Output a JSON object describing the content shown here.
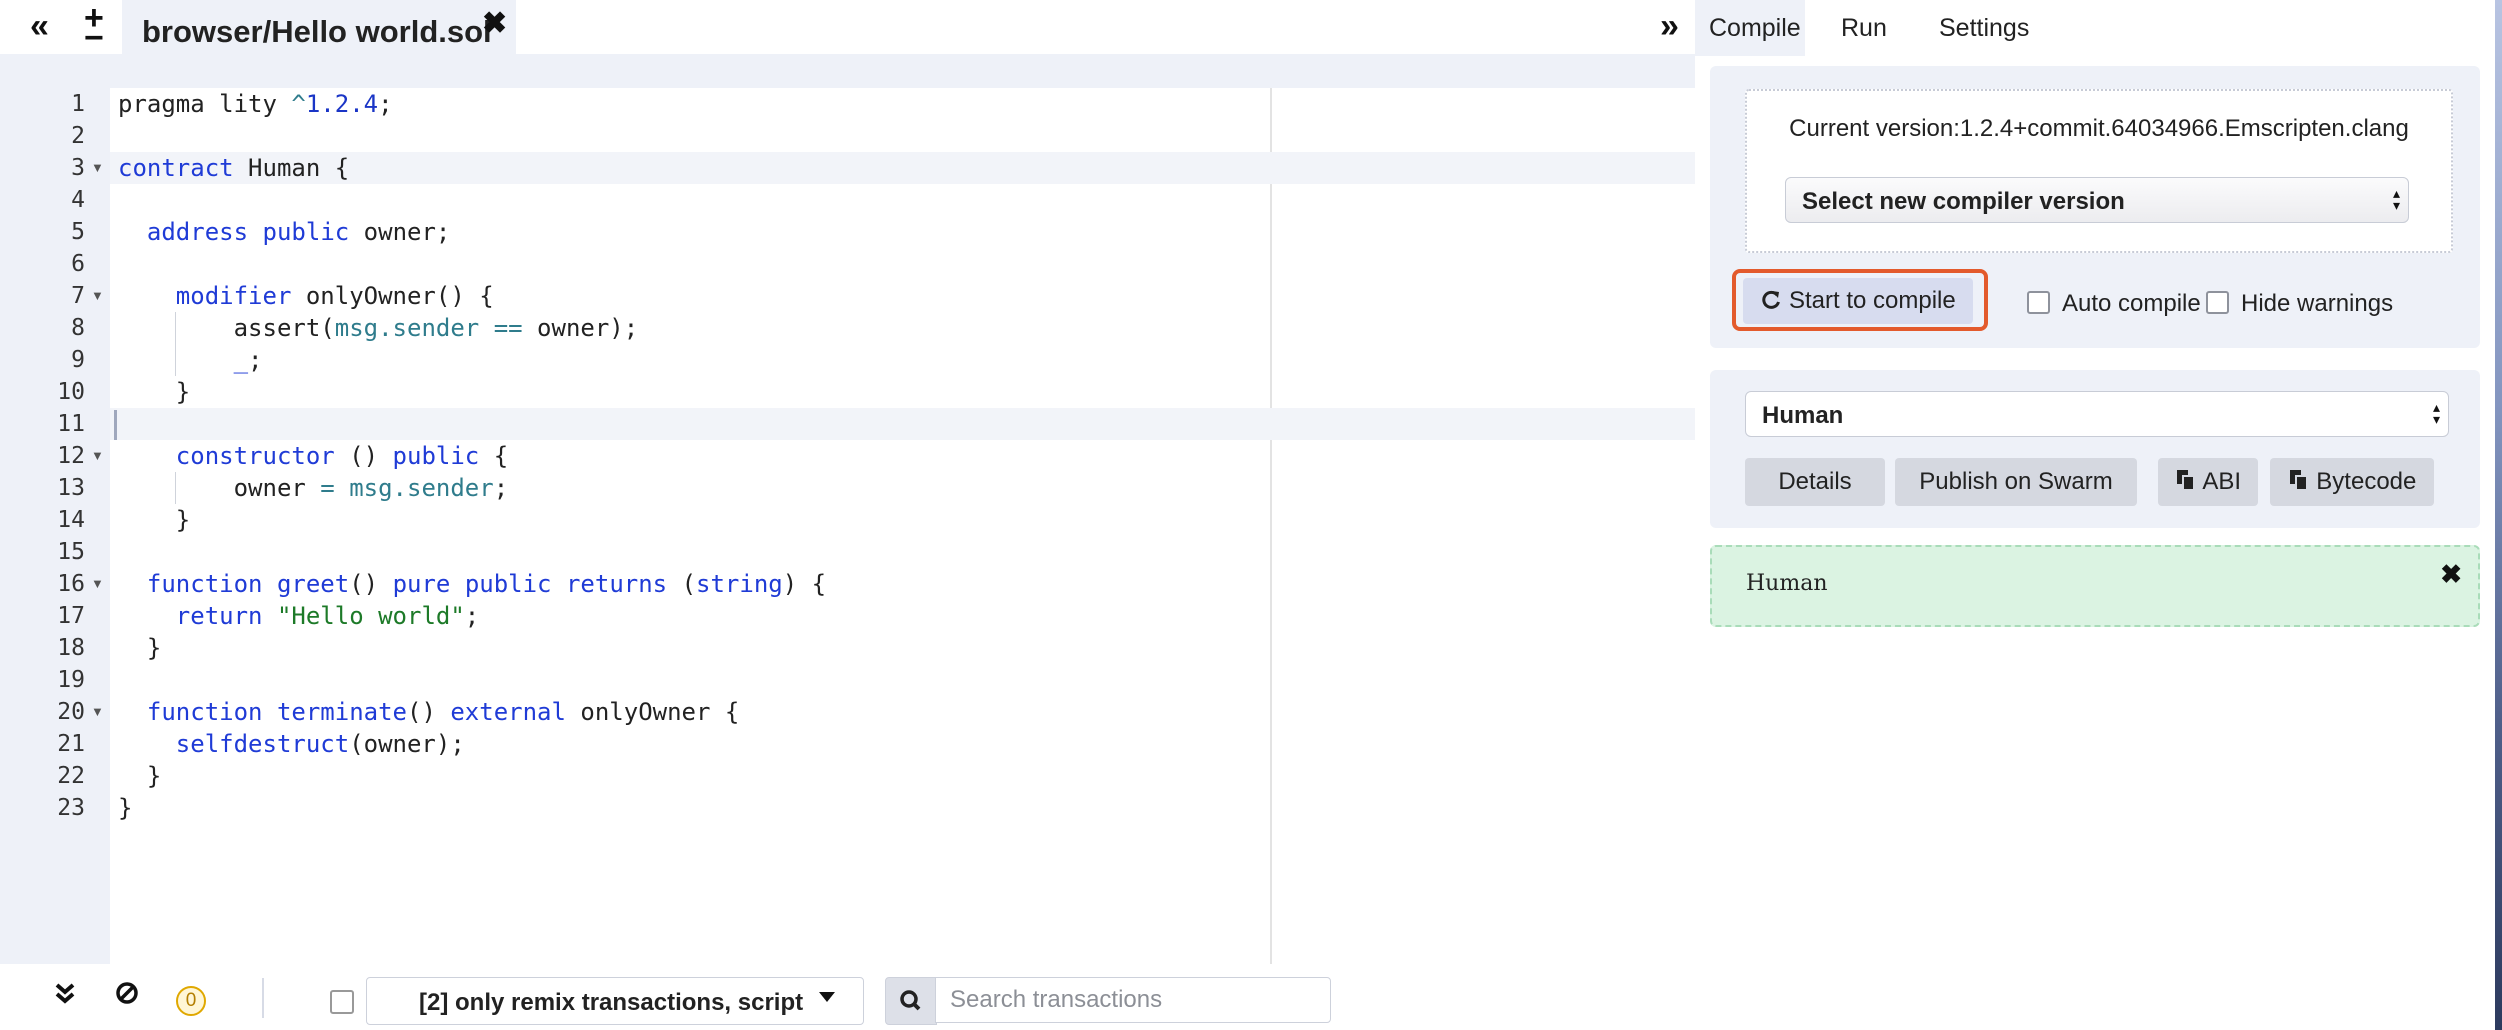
{
  "window": {
    "collapse_left_icon": "«",
    "new_file_icon": "+",
    "file_minus_icon": "−",
    "expand_right_icon": "»"
  },
  "file_tab": {
    "label": "browser/Hello world.sol",
    "close_icon": "✖"
  },
  "editor": {
    "lines": [
      {
        "n": "1",
        "fold": false
      },
      {
        "n": "2",
        "fold": false
      },
      {
        "n": "3",
        "fold": true
      },
      {
        "n": "4",
        "fold": false
      },
      {
        "n": "5",
        "fold": false
      },
      {
        "n": "6",
        "fold": false
      },
      {
        "n": "7",
        "fold": true
      },
      {
        "n": "8",
        "fold": false
      },
      {
        "n": "9",
        "fold": false
      },
      {
        "n": "10",
        "fold": false
      },
      {
        "n": "11",
        "fold": false
      },
      {
        "n": "12",
        "fold": true
      },
      {
        "n": "13",
        "fold": false
      },
      {
        "n": "14",
        "fold": false
      },
      {
        "n": "15",
        "fold": false
      },
      {
        "n": "16",
        "fold": true
      },
      {
        "n": "17",
        "fold": false
      },
      {
        "n": "18",
        "fold": false
      },
      {
        "n": "19",
        "fold": false
      },
      {
        "n": "20",
        "fold": true
      },
      {
        "n": "21",
        "fold": false
      },
      {
        "n": "22",
        "fold": false
      },
      {
        "n": "23",
        "fold": false
      }
    ],
    "code": [
      {
        "t": "pragma lity ",
        "c": ""
      },
      {
        "t": "^",
        "c": "op"
      },
      {
        "t": "1.2.4",
        "c": "num"
      },
      {
        "t": ";",
        "c": ""
      }
    ],
    "code_lines": [
      [
        [
          "pragma lity ",
          ""
        ],
        [
          "^",
          "op"
        ],
        [
          "1.2.4",
          "num"
        ],
        [
          ";",
          ""
        ]
      ],
      [],
      [
        [
          "contract",
          "kw"
        ],
        [
          " Human {",
          ""
        ]
      ],
      [],
      [
        [
          "  ",
          ""
        ],
        [
          "address",
          "ty"
        ],
        [
          " ",
          ""
        ],
        [
          "public",
          "kw"
        ],
        [
          " owner;",
          ""
        ]
      ],
      [],
      [
        [
          "    ",
          ""
        ],
        [
          "modifier",
          "kw"
        ],
        [
          " onlyOwner() {",
          ""
        ]
      ],
      [
        [
          "        assert(",
          ""
        ],
        [
          "msg.sender",
          "prop"
        ],
        [
          " ",
          ""
        ],
        [
          "==",
          "op"
        ],
        [
          " owner);",
          ""
        ]
      ],
      [
        [
          "        ",
          ""
        ],
        [
          "_",
          "kw"
        ],
        [
          ";",
          ""
        ]
      ],
      [
        [
          "    }",
          ""
        ]
      ],
      [],
      [
        [
          "    ",
          ""
        ],
        [
          "constructor",
          "kw"
        ],
        [
          " () ",
          ""
        ],
        [
          "public",
          "kw"
        ],
        [
          " {",
          ""
        ]
      ],
      [
        [
          "        owner ",
          ""
        ],
        [
          "=",
          "op"
        ],
        [
          " ",
          ""
        ],
        [
          "msg.sender",
          "prop"
        ],
        [
          ";",
          ""
        ]
      ],
      [
        [
          "    }",
          ""
        ]
      ],
      [],
      [
        [
          "  ",
          ""
        ],
        [
          "function",
          "kw"
        ],
        [
          " ",
          ""
        ],
        [
          "greet",
          "kw"
        ],
        [
          "() ",
          ""
        ],
        [
          "pure",
          "kw"
        ],
        [
          " ",
          ""
        ],
        [
          "public",
          "kw"
        ],
        [
          " ",
          ""
        ],
        [
          "returns",
          "kw"
        ],
        [
          " (",
          ""
        ],
        [
          "string",
          "ty"
        ],
        [
          ") {",
          ""
        ]
      ],
      [
        [
          "    ",
          ""
        ],
        [
          "return",
          "kw"
        ],
        [
          " ",
          ""
        ],
        [
          "\"Hello world\"",
          "str"
        ],
        [
          ";",
          ""
        ]
      ],
      [
        [
          "  }",
          ""
        ]
      ],
      [],
      [
        [
          "  ",
          ""
        ],
        [
          "function",
          "kw"
        ],
        [
          " ",
          ""
        ],
        [
          "terminate",
          "kw"
        ],
        [
          "() ",
          ""
        ],
        [
          "external",
          "kw"
        ],
        [
          " onlyOwner {",
          ""
        ]
      ],
      [
        [
          "    ",
          ""
        ],
        [
          "selfdestruct",
          "kw"
        ],
        [
          "(owner);",
          ""
        ]
      ],
      [
        [
          "  }",
          ""
        ]
      ],
      [
        [
          "}",
          ""
        ]
      ]
    ]
  },
  "terminal": {
    "collapse_icon": "chevrons-down",
    "clear_icon": "ban",
    "pending_count": "0",
    "filter_label": "[2] only remix transactions, script",
    "search_placeholder": "Search transactions"
  },
  "right_panel": {
    "tabs": [
      {
        "label": "Compile",
        "active": true
      },
      {
        "label": "Run",
        "active": false
      },
      {
        "label": "Settings",
        "active": false
      }
    ],
    "current_version": "Current version:1.2.4+commit.64034966.Emscripten.clang",
    "compiler_select": "Select new compiler version",
    "compile_button": "Start to compile",
    "auto_compile_label": "Auto compile",
    "hide_warnings_label": "Hide warnings",
    "contract_select": "Human",
    "details_button": "Details",
    "publish_button": "Publish on Swarm",
    "abi_button": "ABI",
    "bytecode_button": "Bytecode",
    "result_label": "Human",
    "result_close_icon": "✖"
  },
  "colors": {
    "accent_highlight": "#e35a2c",
    "panel_bg": "#eef1f8",
    "success_bg": "#dbf3e2",
    "keyword": "#1f3bd6",
    "string": "#1d7a28"
  }
}
